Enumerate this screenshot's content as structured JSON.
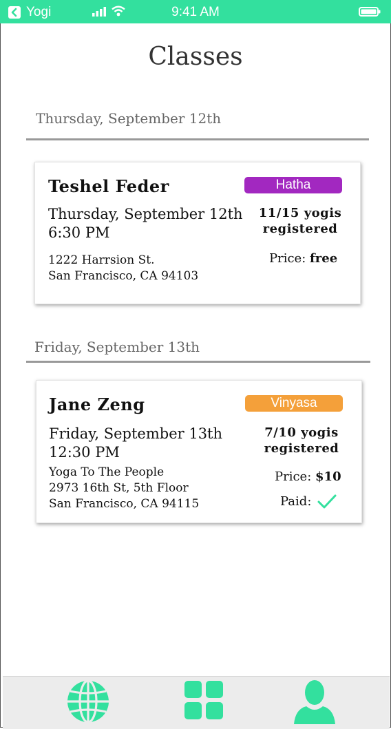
{
  "status_bar": {
    "back_app": "Yogi",
    "time": "9:41 AM"
  },
  "title": "Classes",
  "sections": [
    {
      "date_header": "Thursday, September 12th",
      "class": {
        "teacher": "Teshel Feder",
        "date": "Thursday, September 12th",
        "time": "6:30 PM",
        "address_lines": [
          "1222 Harrsion St.",
          "San Francisco, CA 94103"
        ],
        "style": "Hatha",
        "style_color": "#a228c0",
        "registered_line1": "11/15 yogis",
        "registered_line2": "registered",
        "price_label": "Price:",
        "price_value": "free"
      }
    },
    {
      "date_header": "Friday, September 13th",
      "class": {
        "teacher": "Jane Zeng",
        "date": "Friday, September 13th",
        "time": "12:30 PM",
        "address_lines": [
          "Yoga To The People",
          "2973 16th St, 5th Floor",
          "San Francisco, CA 94115"
        ],
        "style": "Vinyasa",
        "style_color": "#f4a03a",
        "registered_line1": "7/10 yogis",
        "registered_line2": "registered",
        "price_label": "Price:",
        "price_value": "$10",
        "paid_label": "Paid:",
        "paid": true
      }
    }
  ],
  "tabs": [
    {
      "icon": "globe-icon"
    },
    {
      "icon": "grid-icon"
    },
    {
      "icon": "profile-icon"
    }
  ],
  "colors": {
    "accent": "#33e09e"
  }
}
